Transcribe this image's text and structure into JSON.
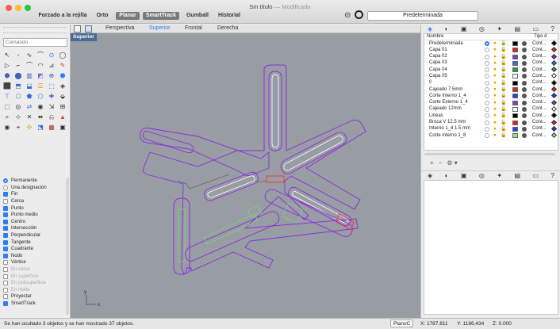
{
  "window": {
    "title": "Sin título",
    "modified": "— Modificado"
  },
  "toolbar": {
    "buttons": [
      {
        "label": "Forzado a la rejilla",
        "on": false
      },
      {
        "label": "Orto",
        "on": false
      },
      {
        "label": "Planar",
        "on": true
      },
      {
        "label": "SmartTrack",
        "on": true
      },
      {
        "label": "Gumball",
        "on": false
      },
      {
        "label": "Historial",
        "on": false
      }
    ],
    "current_layer": "Predeterminada"
  },
  "command": {
    "placeholder": "Comando"
  },
  "viewport_tabs": [
    "Perspectiva",
    "Superior",
    "Frontal",
    "Derecha"
  ],
  "active_tab": "Superior",
  "viewport": {
    "label": "Superior",
    "axis_y": "y",
    "axis_x": "x"
  },
  "snaps": [
    {
      "label": "Permanente",
      "type": "radio",
      "on": true
    },
    {
      "label": "Una designación",
      "type": "radio",
      "on": false
    },
    {
      "label": "Fin",
      "type": "check",
      "on": true
    },
    {
      "label": "Cerca",
      "type": "check",
      "on": false
    },
    {
      "label": "Punto",
      "type": "check",
      "on": true
    },
    {
      "label": "Punto medio",
      "type": "check",
      "on": true
    },
    {
      "label": "Centro",
      "type": "check",
      "on": true
    },
    {
      "label": "Intersección",
      "type": "check",
      "on": true
    },
    {
      "label": "Perpendicular",
      "type": "check",
      "on": true
    },
    {
      "label": "Tangente",
      "type": "check",
      "on": true
    },
    {
      "label": "Cuadrante",
      "type": "check",
      "on": true
    },
    {
      "label": "Nodo",
      "type": "check",
      "on": true
    },
    {
      "label": "Vértice",
      "type": "check",
      "on": false
    },
    {
      "label": "En curva",
      "type": "check",
      "on": false,
      "dim": true
    },
    {
      "label": "En superficie",
      "type": "check",
      "on": false,
      "dim": true
    },
    {
      "label": "En polisuperficie",
      "type": "check",
      "on": false,
      "dim": true
    },
    {
      "label": "En malla",
      "type": "check",
      "on": false,
      "dim": true
    },
    {
      "label": "Proyectar",
      "type": "check",
      "on": false
    },
    {
      "label": "SmartTrack",
      "type": "check",
      "on": true
    }
  ],
  "layers": {
    "header_name": "Nombre",
    "header_type": "Tipo d",
    "rows": [
      {
        "name": "Predeterminada",
        "current": true,
        "color": "#000000",
        "line": "Cont...",
        "dia": "#000000"
      },
      {
        "name": "Capa 01",
        "current": false,
        "color": "#e02020",
        "line": "Cont...",
        "dia": "#e02020"
      },
      {
        "name": "Capa 02",
        "current": false,
        "color": "#7040c0",
        "line": "Cont...",
        "dia": "#7040c0"
      },
      {
        "name": "Capa 03",
        "current": false,
        "color": "#3070e0",
        "line": "Cont...",
        "dia": "#3070e0"
      },
      {
        "name": "Capa 04",
        "current": false,
        "color": "#20a040",
        "line": "Cont...",
        "dia": "#20a040"
      },
      {
        "name": "Capa 05",
        "current": false,
        "color": "#ffffff",
        "line": "Cont...",
        "dia": "#ffffff"
      },
      {
        "name": "0",
        "current": false,
        "color": "#000000",
        "line": "Cont...",
        "dia": "#000000"
      },
      {
        "name": "Cajeado 7.5mm",
        "current": false,
        "color": "#e02020",
        "line": "Cont...",
        "dia": "#e02020"
      },
      {
        "name": "Corte Interno 1_4",
        "current": false,
        "color": "#2040e0",
        "line": "Cont...",
        "dia": "#2040e0"
      },
      {
        "name": "Corte Externo 1_4",
        "current": false,
        "color": "#8040c0",
        "line": "Cont...",
        "dia": "#8040c0"
      },
      {
        "name": "Cajeado 12mm",
        "current": false,
        "color": "#ffffff",
        "line": "Cont...",
        "dia": "#ffffff"
      },
      {
        "name": "Lineas",
        "current": false,
        "color": "#000000",
        "line": "Cont...",
        "dia": "#000000"
      },
      {
        "name": "Broca V 12.5 mm",
        "current": false,
        "color": "#e02020",
        "line": "Cont...",
        "dia": "#e02020"
      },
      {
        "name": "Interno 1_4 1.5 mm",
        "current": false,
        "color": "#2040e0",
        "line": "Cont...",
        "dia": "#2040e0"
      },
      {
        "name": "Corte interno 1_8",
        "current": false,
        "color": "#a0d890",
        "line": "Cont...",
        "dia": "#a0d890"
      }
    ]
  },
  "status": {
    "message": "Se han ocultado 3 objetos y se han mostrado 37 objetos.",
    "plane": "PlanoC",
    "x": "X: 1787.811",
    "y": "Y: 1186.434",
    "z": "Z: 0.000"
  },
  "colors": {
    "accent": "#2e7cf6",
    "viewport_bg": "#989ca3",
    "curve_purple": "#8a2be2",
    "curve_white": "#ffffff",
    "curve_green": "#7cd67c",
    "curve_red": "#ff3030",
    "curve_gray": "#555555"
  }
}
